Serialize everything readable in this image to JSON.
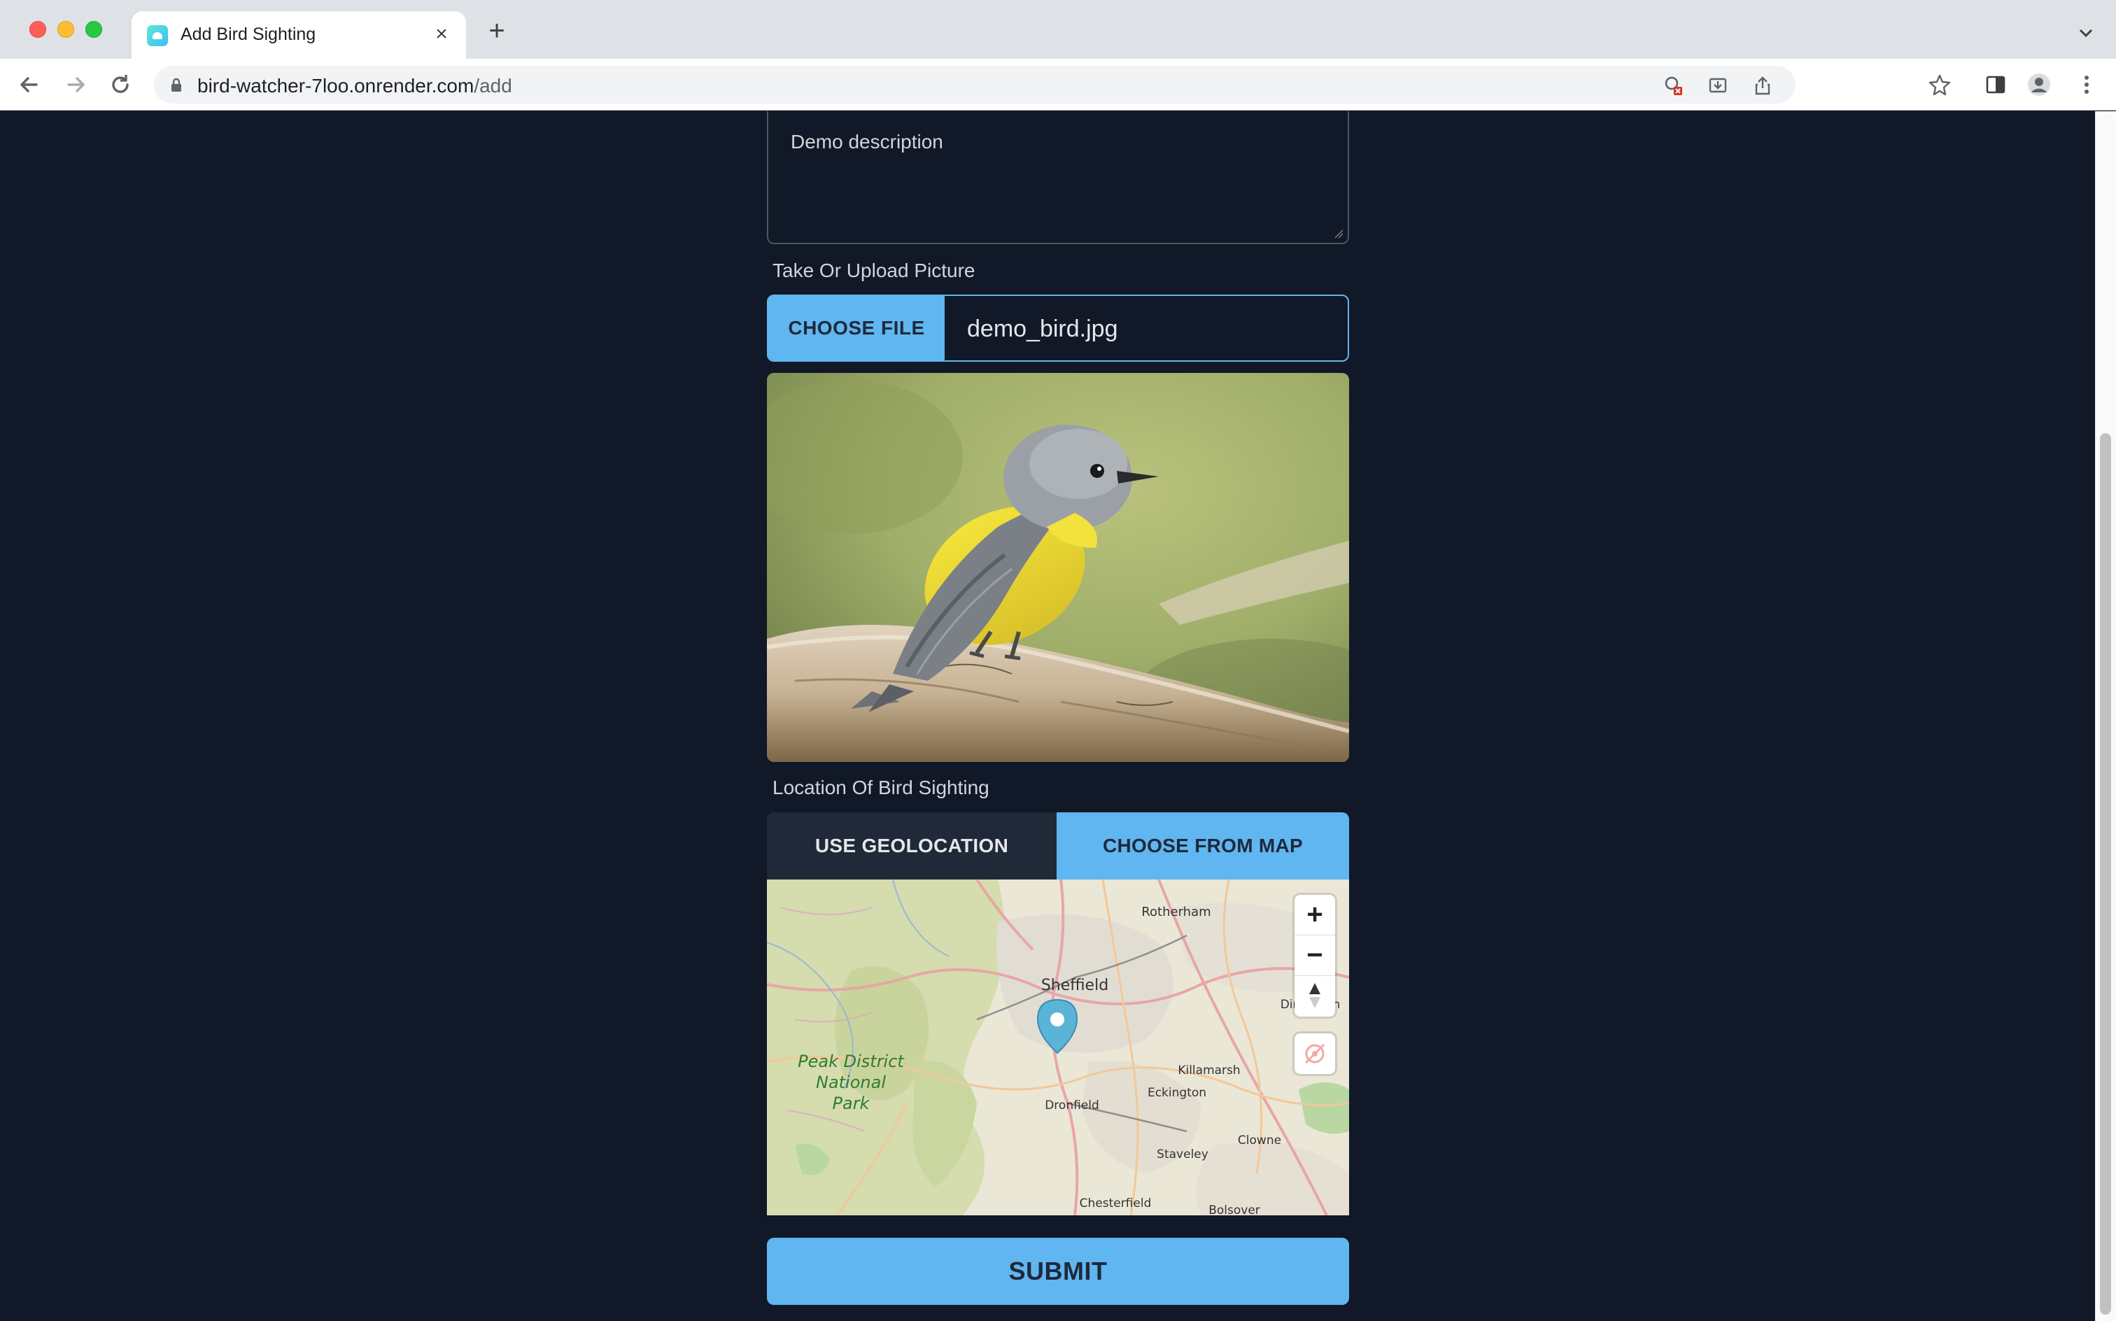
{
  "browser": {
    "tab_title": "Add Bird Sighting",
    "url_host": "bird-watcher-7loo.onrender.com",
    "url_path": "/add",
    "window_controls": [
      "close",
      "minimize",
      "maximize"
    ],
    "toolbar_icons": [
      "back-icon",
      "forward-icon",
      "reload-icon",
      "lock-icon",
      "blocked-popup-icon",
      "install-icon",
      "share-icon",
      "bookmark-star-icon",
      "side-panel-icon",
      "profile-icon",
      "menu-icon"
    ]
  },
  "form": {
    "description_value": "Demo description",
    "picture_label": "Take Or Upload Picture",
    "choose_file_label": "CHOOSE FILE",
    "file_name": "demo_bird.jpg",
    "location_label": "Location Of Bird Sighting",
    "use_geolocation_label": "USE GEOLOCATION",
    "choose_from_map_label": "CHOOSE FROM MAP",
    "submit_label": "SUBMIT"
  },
  "map": {
    "zoom_in": "+",
    "zoom_out": "−",
    "places": [
      {
        "name": "Rotherham"
      },
      {
        "name": "Sheffield"
      },
      {
        "name": "Peak District"
      },
      {
        "name": "National"
      },
      {
        "name": "Park"
      },
      {
        "name": "Killamarsh"
      },
      {
        "name": "Eckington"
      },
      {
        "name": "Dronfield"
      },
      {
        "name": "Staveley"
      },
      {
        "name": "Clowne"
      },
      {
        "name": "Chesterfield"
      },
      {
        "name": "Bolsover"
      },
      {
        "name": "Din"
      },
      {
        "name": "n"
      }
    ]
  },
  "colors": {
    "page_bg": "#111827",
    "accent": "#60b6f0",
    "inactive_tab": "#1f2937",
    "marker": "#5ab4d8"
  }
}
